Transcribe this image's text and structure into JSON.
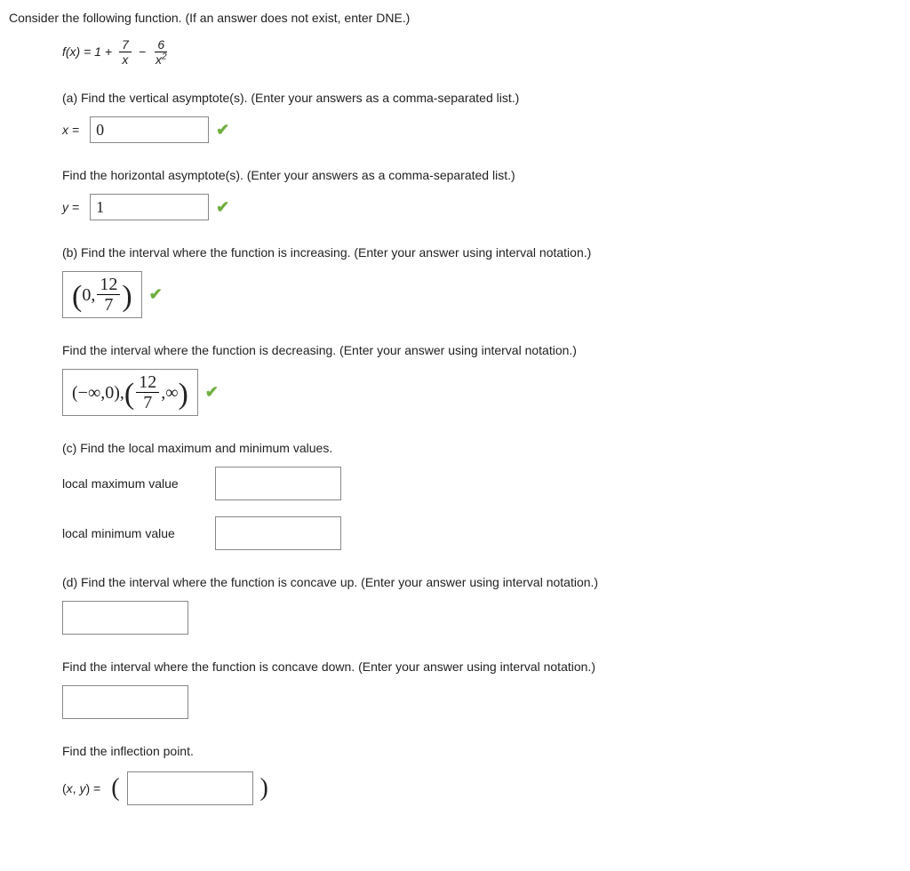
{
  "intro": "Consider the following function. (If an answer does not exist, enter DNE.)",
  "func": {
    "lhs": "f(x) = 1 +",
    "frac1_num": "7",
    "frac1_den": "x",
    "minus": "−",
    "frac2_num": "6",
    "frac2_den": "x",
    "frac2_exp": "2"
  },
  "a": {
    "prompt": "(a) Find the vertical asymptote(s). (Enter your answers as a comma-separated list.)",
    "x_label": "x = ",
    "x_value": "0",
    "h_prompt": "Find the horizontal asymptote(s). (Enter your answers as a comma-separated list.)",
    "y_label": "y = ",
    "y_value": "1"
  },
  "b": {
    "prompt": "(b) Find the interval where the function is increasing. (Enter your answer using interval notation.)",
    "inc_lead": "0,",
    "inc_num": "12",
    "inc_den": "7",
    "dec_prompt": "Find the interval where the function is decreasing. (Enter your answer using interval notation.)",
    "dec_first": "(−∞,0),",
    "dec_num": "12",
    "dec_den": "7",
    "dec_tail": ",∞"
  },
  "c": {
    "prompt": "(c) Find the local maximum and minimum values.",
    "max_label": "local maximum value",
    "min_label": "local minimum value"
  },
  "d": {
    "up_prompt": "(d) Find the interval where the function is concave up. (Enter your answer using interval notation.)",
    "down_prompt": "Find the interval where the function is concave down. (Enter your answer using interval notation.)",
    "infl_prompt": "Find the inflection point.",
    "infl_label": "(x, y) = "
  },
  "check": "✔"
}
